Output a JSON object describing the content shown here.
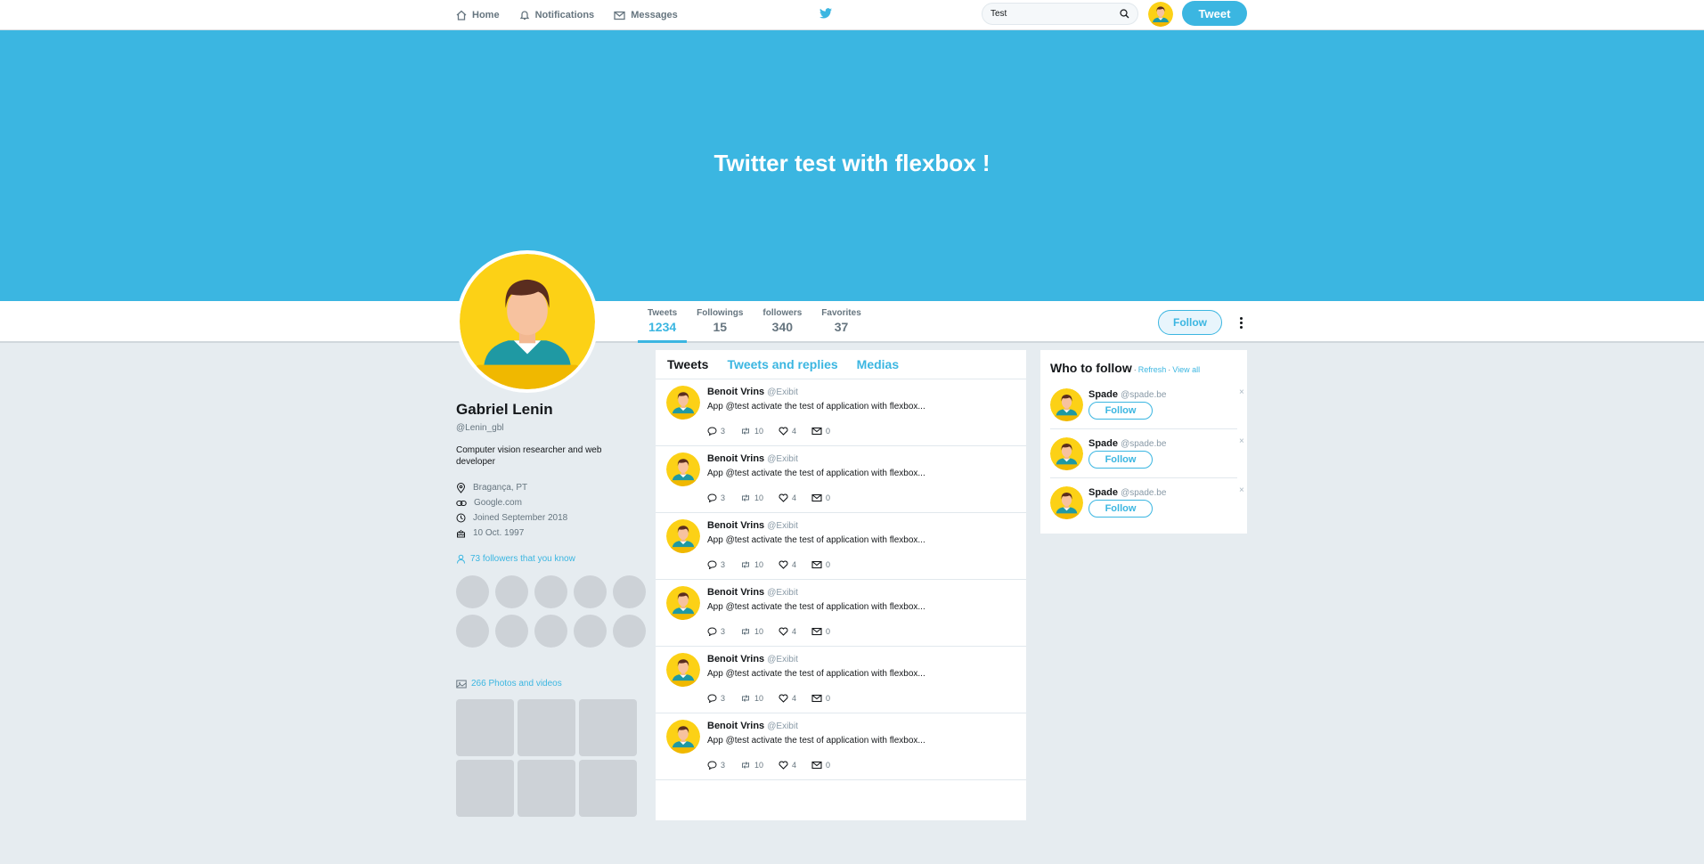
{
  "nav": {
    "home": "Home",
    "notifications": "Notifications",
    "messages": "Messages",
    "search_value": "Test",
    "tweet_button": "Tweet"
  },
  "banner": {
    "title": "Twitter test with flexbox !"
  },
  "stats": [
    {
      "label": "Tweets",
      "value": "1234"
    },
    {
      "label": "Followings",
      "value": "15"
    },
    {
      "label": "followers",
      "value": "340"
    },
    {
      "label": "Favorites",
      "value": "37"
    }
  ],
  "follow_button": "Follow",
  "profile": {
    "name": "Gabriel Lenin",
    "handle": "@Lenin_gbl",
    "bio": "Computer vision researcher and web developer",
    "location": "Bragança, PT",
    "website": "Google.com",
    "joined": "Joined September 2018",
    "birthday": "10 Oct. 1997",
    "followers_you_know": "73 followers that you know",
    "photos_videos": "266 Photos and videos"
  },
  "timeline": {
    "tabs": [
      "Tweets",
      "Tweets and replies",
      "Medias"
    ],
    "tweets": [
      {
        "name": "Benoit Vrins",
        "handle": "@Exibit",
        "text": "App @test activate the test of application with flexbox...",
        "replies": "3",
        "retweets": "10",
        "likes": "4",
        "messages": "0"
      },
      {
        "name": "Benoit Vrins",
        "handle": "@Exibit",
        "text": "App @test activate the test of application with flexbox...",
        "replies": "3",
        "retweets": "10",
        "likes": "4",
        "messages": "0"
      },
      {
        "name": "Benoit Vrins",
        "handle": "@Exibit",
        "text": "App @test activate the test of application with flexbox...",
        "replies": "3",
        "retweets": "10",
        "likes": "4",
        "messages": "0"
      },
      {
        "name": "Benoit Vrins",
        "handle": "@Exibit",
        "text": "App @test activate the test of application with flexbox...",
        "replies": "3",
        "retweets": "10",
        "likes": "4",
        "messages": "0"
      },
      {
        "name": "Benoit Vrins",
        "handle": "@Exibit",
        "text": "App @test activate the test of application with flexbox...",
        "replies": "3",
        "retweets": "10",
        "likes": "4",
        "messages": "0"
      },
      {
        "name": "Benoit Vrins",
        "handle": "@Exibit",
        "text": "App @test activate the test of application with flexbox...",
        "replies": "3",
        "retweets": "10",
        "likes": "4",
        "messages": "0"
      }
    ]
  },
  "who_to_follow": {
    "title": "Who to follow",
    "separator": "·",
    "refresh": "Refresh",
    "view_all": "View all",
    "close_glyph": "×",
    "suggestions": [
      {
        "name": "Spade",
        "handle": "@spade.be",
        "button": "Follow"
      },
      {
        "name": "Spade",
        "handle": "@spade.be",
        "button": "Follow"
      },
      {
        "name": "Spade",
        "handle": "@spade.be",
        "button": "Follow"
      }
    ]
  },
  "colors": {
    "accent": "#3bb6e1",
    "avatar_bg": "#fcd116",
    "shirt": "#1f99a3",
    "background": "#e6ecf0"
  },
  "icons": [
    "home-icon",
    "bell-icon",
    "envelope-icon",
    "twitter-bird-icon",
    "search-icon",
    "location-icon",
    "link-icon",
    "clock-icon",
    "cake-icon",
    "person-icon",
    "photo-icon",
    "reply-icon",
    "retweet-icon",
    "heart-icon",
    "message-icon",
    "more-icon"
  ]
}
